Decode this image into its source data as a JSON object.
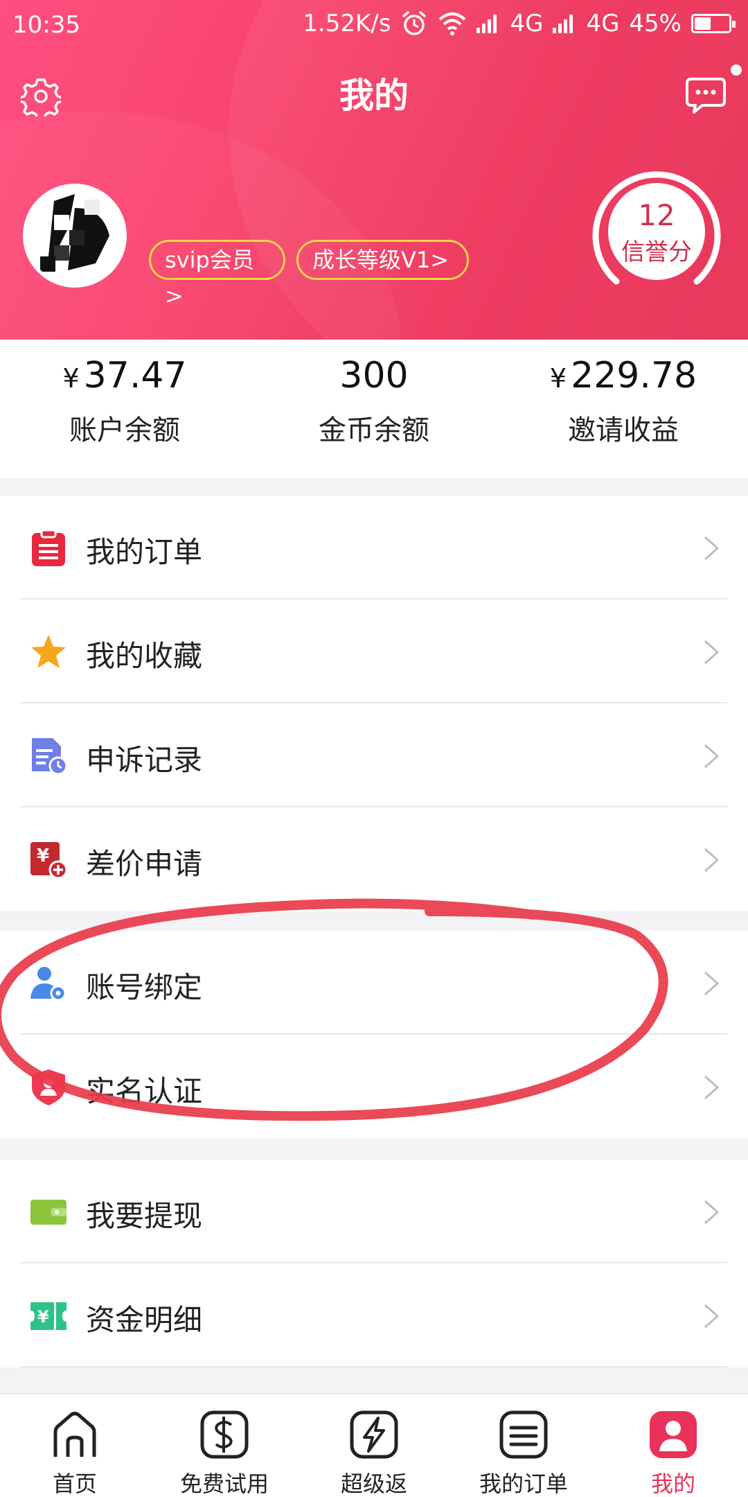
{
  "status_bar": {
    "time": "10:35",
    "speed": "1.52K/s",
    "net1": "4G",
    "net2": "4G",
    "battery": "45%",
    "battery_level": 0.45
  },
  "header": {
    "title": "我的"
  },
  "profile": {
    "badge_vip": "svip会员>",
    "badge_level": "成长等级V1>",
    "credit_score": "12",
    "credit_label": "信誉分"
  },
  "stats": [
    {
      "currency": "¥",
      "value": "37.47",
      "label": "账户余额"
    },
    {
      "currency": "",
      "value": "300",
      "label": "金币余额"
    },
    {
      "currency": "¥",
      "value": "229.78",
      "label": "邀请收益"
    }
  ],
  "menu": [
    {
      "label": "我的订单",
      "icon": "clipboard-icon",
      "color": "#e8283f"
    },
    {
      "label": "我的收藏",
      "icon": "star-icon",
      "color": "#f7a51c"
    },
    {
      "label": "申诉记录",
      "icon": "document-clock-icon",
      "color": "#6f7fe6"
    },
    {
      "label": "差价申请",
      "icon": "yen-plus-icon",
      "color": "#c22a30"
    },
    {
      "label": "账号绑定",
      "icon": "user-gear-icon",
      "color": "#4a8ae6"
    },
    {
      "label": "实名认证",
      "icon": "shield-user-icon",
      "color": "#ee3b52"
    },
    {
      "label": "我要提现",
      "icon": "wallet-icon",
      "color": "#8cc43c"
    },
    {
      "label": "资金明细",
      "icon": "ticket-yen-icon",
      "color": "#2cc38a"
    }
  ],
  "tabs": [
    {
      "label": "首页",
      "icon": "home-icon"
    },
    {
      "label": "免费试用",
      "icon": "dollar-icon"
    },
    {
      "label": "超级返",
      "icon": "lightning-icon"
    },
    {
      "label": "我的订单",
      "icon": "list-icon"
    },
    {
      "label": "我的",
      "icon": "profile-icon"
    }
  ],
  "colors": {
    "primary": "#f0395f",
    "badge_border": "#f5d34b",
    "annotation": "#e83a4a"
  }
}
